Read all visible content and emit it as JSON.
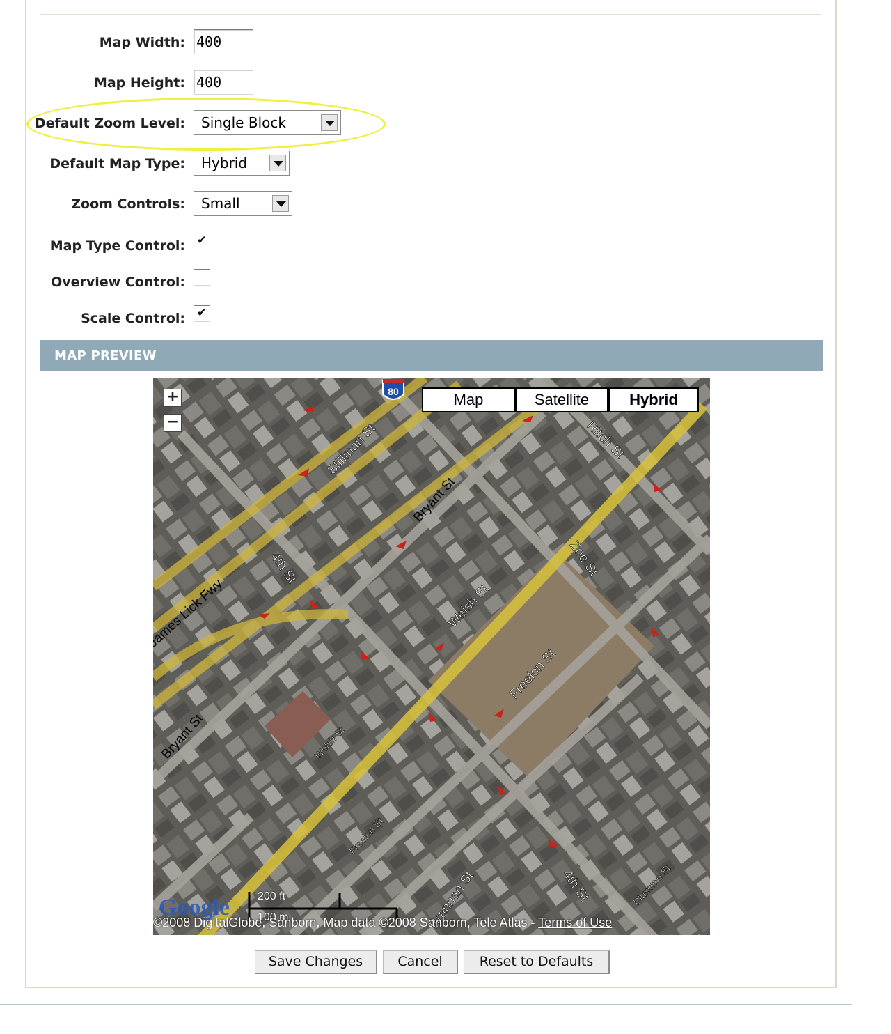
{
  "form": {
    "map_width": {
      "label": "Map Width:",
      "value": "400"
    },
    "map_height": {
      "label": "Map Height:",
      "value": "400"
    },
    "default_zoom_level": {
      "label": "Default Zoom Level:",
      "value": "Single Block"
    },
    "default_map_type": {
      "label": "Default Map Type:",
      "value": "Hybrid"
    },
    "zoom_controls": {
      "label": "Zoom Controls:",
      "value": "Small"
    },
    "map_type_control": {
      "label": "Map Type Control:",
      "checked": true,
      "mark": "✔"
    },
    "overview_control": {
      "label": "Overview Control:",
      "checked": false,
      "mark": ""
    },
    "scale_control": {
      "label": "Scale Control:",
      "checked": true,
      "mark": "✔"
    }
  },
  "highlight_color": "#f1ef3c",
  "preview": {
    "header": "MAP PREVIEW",
    "header_color": "#8fa9b6",
    "map": {
      "zoom_in": "+",
      "zoom_out": "−",
      "map_types": [
        "Map",
        "Satellite",
        "Hybrid"
      ],
      "active_map_type": "Hybrid",
      "interstate_shield": "80",
      "streets": [
        "Stillman St",
        "Bryant St",
        "Ritch St",
        "Zoe St",
        "4th St",
        "Welsh St",
        "James Lick Fwy",
        "Freelon St",
        "Bluxome St",
        "Brannan St"
      ],
      "scale_ft": "200 ft",
      "scale_m": "100 m",
      "logo": "Google",
      "copyright": "©2008 DigitalGlobe, Sanborn, Map data ©2008 Sanborn, Tele Atlas - ",
      "terms_link": "Terms of Use"
    }
  },
  "actions": {
    "save": "Save Changes",
    "cancel": "Cancel",
    "reset": "Reset to Defaults"
  }
}
